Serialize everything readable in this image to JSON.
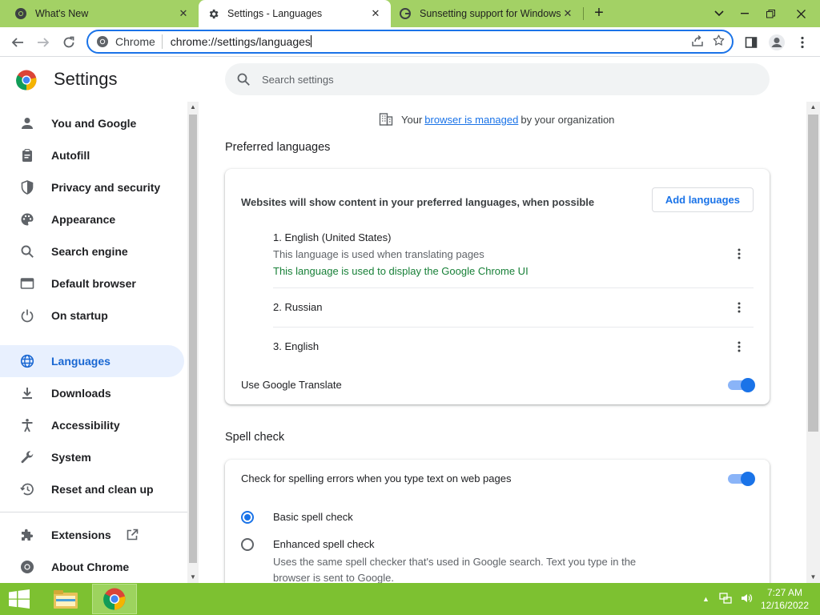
{
  "tabs": [
    {
      "title": "What's New",
      "active": false
    },
    {
      "title": "Settings - Languages",
      "active": true
    },
    {
      "title": "Sunsetting support for Windows",
      "active": false
    }
  ],
  "toolbar": {
    "omnibox_chip": "Chrome",
    "url": "chrome://settings/languages"
  },
  "settings": {
    "title": "Settings",
    "search_placeholder": "Search settings"
  },
  "sidebar": {
    "items": [
      {
        "label": "You and Google",
        "icon": "person-icon"
      },
      {
        "label": "Autofill",
        "icon": "clipboard-icon"
      },
      {
        "label": "Privacy and security",
        "icon": "shield-icon"
      },
      {
        "label": "Appearance",
        "icon": "palette-icon"
      },
      {
        "label": "Search engine",
        "icon": "search-icon"
      },
      {
        "label": "Default browser",
        "icon": "browser-window-icon"
      },
      {
        "label": "On startup",
        "icon": "power-icon"
      },
      {
        "label": "Languages",
        "icon": "globe-icon",
        "active": true
      },
      {
        "label": "Downloads",
        "icon": "download-icon"
      },
      {
        "label": "Accessibility",
        "icon": "accessibility-icon"
      },
      {
        "label": "System",
        "icon": "wrench-icon"
      },
      {
        "label": "Reset and clean up",
        "icon": "history-icon"
      }
    ],
    "extensions_label": "Extensions",
    "about_label": "About Chrome"
  },
  "managed": {
    "prefix": "Your",
    "link": "browser is managed",
    "suffix": "by your organization"
  },
  "preferred_languages": {
    "section_title": "Preferred languages",
    "description": "Websites will show content in your preferred languages, when possible",
    "add_button": "Add languages",
    "languages": [
      {
        "name": "1. English (United States)",
        "sub": "This language is used when translating pages",
        "ui_note": "This language is used to display the Google Chrome UI"
      },
      {
        "name": "2. Russian"
      },
      {
        "name": "3. English"
      }
    ],
    "translate_label": "Use Google Translate",
    "translate_on": true
  },
  "spell_check": {
    "section_title": "Spell check",
    "toggle_label": "Check for spelling errors when you type text on web pages",
    "toggle_on": true,
    "basic_label": "Basic spell check",
    "enhanced_label": "Enhanced spell check",
    "enhanced_desc": "Uses the same spell checker that's used in Google search. Text you type in the browser is sent to Google.",
    "selected": "basic"
  },
  "taskbar": {
    "time": "7:27 AM",
    "date": "12/16/2022"
  },
  "colors": {
    "accent": "#1a73e8",
    "tabstrip": "#a3d165",
    "taskbar": "#7dc131",
    "success_text": "#188038"
  }
}
